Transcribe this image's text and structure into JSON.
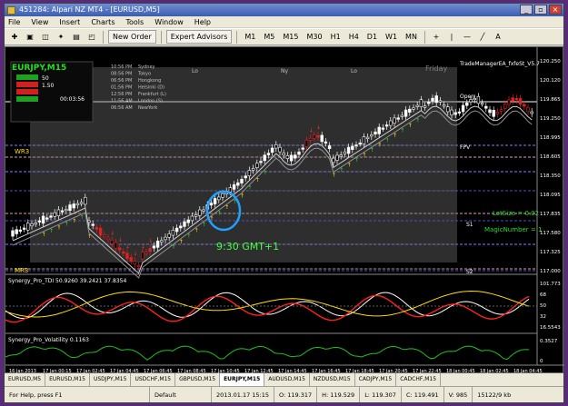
{
  "window": {
    "title": "451284: Alpari NZ MT4 - [EURUSD,M5]",
    "minimize": "_",
    "restore": "▫",
    "close": "×"
  },
  "menu": [
    "File",
    "View",
    "Insert",
    "Charts",
    "Tools",
    "Window",
    "Help"
  ],
  "toolbar": {
    "new_order": "New Order",
    "expert_advisors": "Expert Advisors",
    "timeframes": [
      "M1",
      "M5",
      "M15",
      "M30",
      "H1",
      "H4",
      "D1",
      "W1",
      "MN"
    ]
  },
  "chart": {
    "symbol_label": "EURJPY,M15",
    "sessions": [
      {
        "time": "10:56 PM",
        "city": "Sydney"
      },
      {
        "time": "08:56 PM",
        "city": "Tokyo"
      },
      {
        "time": "06:56 PM",
        "city": "Hongkong"
      },
      {
        "time": "01:56 PM",
        "city": "Helsinki (D)"
      },
      {
        "time": "12:56 PM",
        "city": "Frankfurt (L)"
      },
      {
        "time": "11:56 AM",
        "city": "London (S)"
      },
      {
        "time": "06:56 AM",
        "city": "NewYork"
      }
    ],
    "panel_values": [
      "50",
      "1.50"
    ],
    "countdown": "00:03:56",
    "session_headers": [
      "Lo",
      "Ny",
      "Lo",
      "Friday"
    ],
    "trade_manager": "TradeManagerEA_fxfeSt_V5.7",
    "level_labels": {
      "open": "Open",
      "fpv": "FPV",
      "wr3": "WR3",
      "mr3": "MR3",
      "s1": "S1",
      "s2": "S2"
    },
    "lotsize": "LotSize = 0.02",
    "magic": "MagicNumber = 1",
    "annotation": "9:30 GMT+1",
    "price_ticks": [
      "120.250",
      "120.120",
      "119.865",
      "119.250",
      "118.995",
      "118.605",
      "118.350",
      "118.095",
      "117.835",
      "117.580",
      "117.325",
      "117.000"
    ],
    "tdi_label": "Synergy_Pro_TDI 50.9260 39.2421 37.8354",
    "tdi_ticks": [
      "101.773",
      "68",
      "50",
      "32",
      "16.5543"
    ],
    "vol_label": "Synergy_Pro_Volatility 0.1163",
    "vol_ticks": [
      "0.3527",
      "0"
    ],
    "time_ticks": [
      "16 Jan 2013",
      "17 Jan 00:15",
      "17 Jan 02:45",
      "17 Jan 04:45",
      "17 Jan 06:45",
      "17 Jan 08:45",
      "17 Jan 10:45",
      "17 Jan 12:45",
      "17 Jan 14:45",
      "17 Jan 16:45",
      "17 Jan 18:45",
      "17 Jan 20:45",
      "17 Jan 22:45",
      "18 Jan 00:45",
      "18 Jan 02:45",
      "18 Jan 04:45"
    ]
  },
  "tabs": [
    "EURUSD,M5",
    "EURUSD,M15",
    "USDJPY,M15",
    "USDCHF,M15",
    "GBPUSD,M15",
    "EURJPY,M15",
    "AUDUSD,M15",
    "NZDUSD,M15",
    "CADJPY,M15",
    "CADCHF,M15"
  ],
  "active_tab": "EURJPY,M15",
  "status": {
    "help": "For Help, press F1",
    "profile": "Default",
    "datetime": "2013.01.17 15:15",
    "open": "O: 119.317",
    "high": "H: 119.529",
    "low": "L: 119.307",
    "close": "C: 119.491",
    "volume": "V: 985",
    "traffic": "15122/9 kb"
  },
  "colors": {
    "bull": "#ffffff",
    "bear": "#e02020",
    "tdi_red": "#ff2020",
    "tdi_white": "#ffffff",
    "tdi_yellow": "#ffe000",
    "vol_green": "#20c020",
    "annotation": "#40ff40",
    "highlight_circle": "#20a0ff"
  }
}
